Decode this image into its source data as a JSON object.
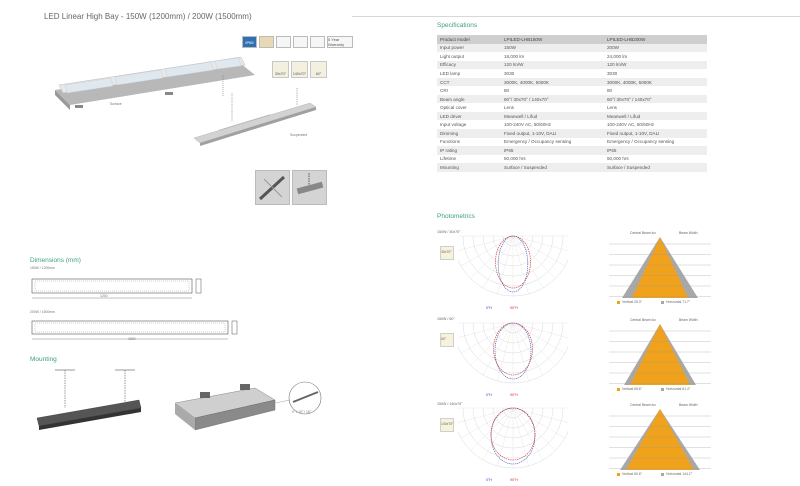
{
  "page_title": "LED Linear High Bay - 150W (1200mm) / 200W (1500mm)",
  "icons": [
    "IP65",
    "5 Year Warranty"
  ],
  "beam_options": [
    "30x70°",
    "140x70°",
    "60°"
  ],
  "image_captions": {
    "surface": "Surface",
    "suspended": "Suspended"
  },
  "specifications": {
    "heading": "Specifications",
    "header": [
      "Product model",
      "LPILED-LHB150W",
      "LPILED-LHB200W"
    ],
    "rows": [
      [
        "Input power",
        "150W",
        "200W"
      ],
      [
        "Light output",
        "18,000 lm",
        "24,000 lm"
      ],
      [
        "Efficacy",
        "120 lm/W",
        "120 lm/W"
      ],
      [
        "LED lamp",
        "3030",
        "3030"
      ],
      [
        "CCT",
        "3000K, 4000K, 5000K",
        "3000K, 4000K, 5000K"
      ],
      [
        "CRI",
        "80",
        "80"
      ],
      [
        "Beam angle",
        "60°/ 30x70° / 140x70°",
        "60°/ 30x70° / 140x70°"
      ],
      [
        "Optical cover",
        "Lens",
        "Lens"
      ],
      [
        "LED driver",
        "Meanwell / Lifud",
        "Meanwell / Lifud"
      ],
      [
        "Input voltage",
        "100-240V AC, 50/60Hz",
        "100-240V AC, 50/60Hz"
      ],
      [
        "Dimming",
        "Fixed output, 1-10V, DALI",
        "Fixed output, 1-10V, DALI"
      ],
      [
        "Functions",
        "Emergency / Occupancy sensing",
        "Emergency / Occupancy sensing"
      ],
      [
        "IP rating",
        "IP65",
        "IP65"
      ],
      [
        "Lifetime",
        "50,000 hrs",
        "50,000 hrs"
      ],
      [
        "Mounting",
        "Surface / Suspended",
        "Surface / Suspended"
      ]
    ]
  },
  "dimensions": {
    "heading": "Dimensions (mm)",
    "variant_1": {
      "label": "150W / 1200mm",
      "length": "1200"
    },
    "variant_2": {
      "label": "200W / 1500mm",
      "length": "1500"
    }
  },
  "mounting": {
    "heading": "Mounting",
    "angles_note": "0° / 10° / 15°"
  },
  "photometrics": {
    "heading": "Photometrics",
    "panels": [
      {
        "label": "150W / 30x70°",
        "chip": "30x70°",
        "legend_left": "0°H",
        "legend_right": "90°H",
        "right_title_left": "Central Beam lux",
        "right_title_right": "Beam Width",
        "right_legend_left": "Vertical 25.3°",
        "right_legend_right": "Horizontal 71.7°"
      },
      {
        "label": "150W / 60°",
        "chip": "60°",
        "legend_left": "0°H",
        "legend_right": "90°H",
        "right_title_left": "Central Beam lux",
        "right_title_right": "Beam Width",
        "right_legend_left": "Vertical 65.6°",
        "right_legend_right": "Horizontal 61.4°"
      },
      {
        "label": "150W / 140x70°",
        "chip": "140x70°",
        "legend_left": "0°H",
        "legend_right": "90°H",
        "right_title_left": "Central Beam lux",
        "right_title_right": "Beam Width",
        "right_legend_left": "Vertical 80.6°",
        "right_legend_right": "Horizontal 144.2°"
      }
    ]
  },
  "colors": {
    "accent": "#3c9e86",
    "beam_fill": "#f0a21c",
    "beam_grey": "#a8a8a8"
  }
}
